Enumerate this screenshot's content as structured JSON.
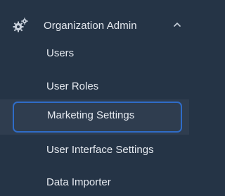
{
  "section": {
    "icon": "gears-icon",
    "label": "Organization Admin",
    "expanded": true
  },
  "items": [
    {
      "label": "Users"
    },
    {
      "label": "User Roles"
    },
    {
      "label": "Marketing Settings",
      "active": true
    },
    {
      "label": "User Interface Settings"
    },
    {
      "label": "Data Importer"
    }
  ],
  "colors": {
    "background": "#253446",
    "active_row": "#2f3d4f",
    "focus_ring": "#2f6cc7",
    "text": "#e6eaf0"
  }
}
